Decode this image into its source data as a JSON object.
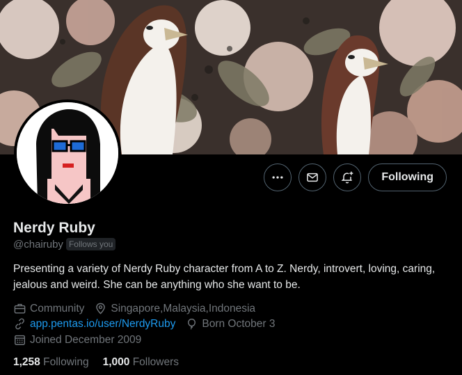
{
  "profile": {
    "name": "Nerdy Ruby",
    "handle": "@chairuby",
    "follows_you": "Follows you",
    "bio": "Presenting a variety of Nerdy Ruby character from A to Z. Nerdy, introvert, loving, caring, jealous and weird. She can be anything who she want to be.",
    "category": "Community",
    "location": "Singapore,Malaysia,Indonesia",
    "website": "app.pentas.io/user/NerdyRuby",
    "birthday": "Born October 3",
    "joined": "Joined December 2009"
  },
  "actions": {
    "more_icon": "more-icon",
    "message_icon": "mail-icon",
    "notify_icon": "bell-plus-icon",
    "following_label": "Following"
  },
  "stats": {
    "following_count": "1,258",
    "following_label": "Following",
    "followers_count": "1,000",
    "followers_label": "Followers"
  },
  "colors": {
    "background": "#000000",
    "text_primary": "#e7e9ea",
    "text_secondary": "#71767b",
    "link": "#1d9bf0",
    "border": "#536471"
  }
}
